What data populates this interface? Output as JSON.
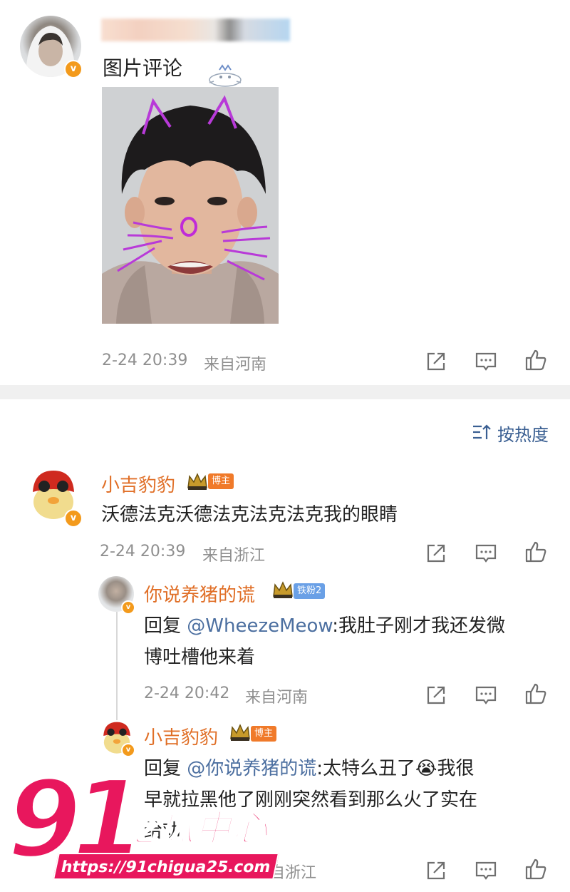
{
  "post": {
    "caption": "图片评论",
    "meta_time": "2-24 20:39",
    "meta_loc": "来自河南",
    "verified_badge": "v"
  },
  "sort": {
    "label": "按热度"
  },
  "comments": [
    {
      "username": "小吉豹豹",
      "tag": "博主",
      "text": "沃德法克沃德法克法克法克我的眼睛",
      "time": "2-24 20:39",
      "loc": "来自浙江"
    }
  ],
  "replies": [
    {
      "username": "你说养猪的谎",
      "tag": "铁粉2",
      "reply_prefix": "回复 ",
      "mention": "@WheezeMeow",
      "text_line1": ":我肚子刚才我还发微",
      "text_line2": "博吐槽他来着",
      "time": "2-24 20:42",
      "loc": "来自河南"
    },
    {
      "username": "小吉豹豹",
      "tag": "博主",
      "reply_prefix": "回复 ",
      "mention": "@你说养猪的谎",
      "text_line1": ":太特么丑了",
      "emoji": "😭",
      "text_line1b": "我很",
      "text_line2": "早就拉黑他了刚刚突然看到那么火了实在",
      "text_line3": "给劝",
      "loc": "自浙江"
    }
  ],
  "watermark": {
    "number": "91",
    "title": "吃瓜中心",
    "url": "https://91chigua25.com"
  },
  "colors": {
    "username": "#e06f27",
    "mention": "#4c6fa0",
    "badge_orange": "#f39a1c",
    "tag_host": "#f07a2a",
    "tag_fan": "#6aa0e6",
    "watermark": "#e8175d"
  }
}
